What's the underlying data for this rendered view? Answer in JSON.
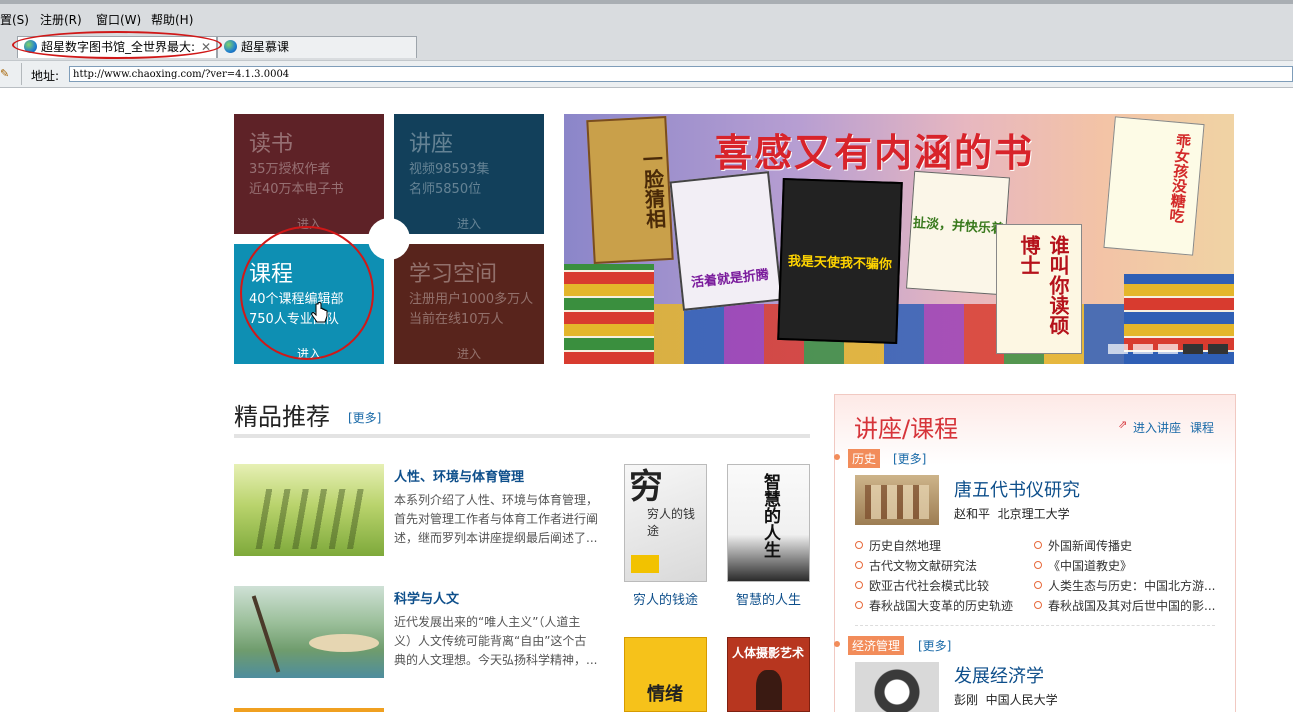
{
  "menubar": {
    "items": [
      "置(S)",
      "注册(R)",
      "窗口(W)",
      "帮助(H)"
    ]
  },
  "tabs": [
    {
      "label": "超星数字图书馆_全世界最大:",
      "active": true
    },
    {
      "label": "超星慕课",
      "active": false
    }
  ],
  "address": {
    "label": "地址:",
    "value": "http://www.chaoxing.com/?ver=4.1.3.0004"
  },
  "tiles": {
    "reading": {
      "title": "读书",
      "line1": "35万授权作者",
      "line2": "近40万本电子书",
      "enter": "进入"
    },
    "lecture": {
      "title": "讲座",
      "line1": "视频98593集",
      "line2": "名师5850位",
      "enter": "进入"
    },
    "course": {
      "title": "课程",
      "line1": "40个课程编辑部",
      "line2": "750人专业团队",
      "enter": "进入"
    },
    "study": {
      "title": "学习空间",
      "line1": "注册用户1000多万人",
      "line2": "当前在线10万人",
      "enter": "进入"
    }
  },
  "banner": {
    "headline": "喜感又有内涵的书",
    "books": [
      "一脸猜相",
      "活着就是折腾",
      "我是天使我不骗你",
      "扯淡，并快乐着",
      "谁叫你读硕博士",
      "乖女孩没糖吃"
    ]
  },
  "recommend": {
    "title": "精品推荐",
    "more": "[更多]",
    "items": [
      {
        "title": "人性、环境与体育管理",
        "desc": [
          "本系列介绍了人性、环境与体育管理，",
          "首先对管理工作者与体育工作者进行阐",
          "述，继而罗列本讲座提纲最后阐述了..."
        ]
      },
      {
        "title": "科学与人文",
        "desc": [
          "近代发展出来的“唯人主义”（人道主",
          "义）人文传统可能背离“自由”这个古",
          "典的人文理想。今天弘扬科学精神，..."
        ]
      }
    ],
    "books": [
      {
        "title": "穷人的钱途",
        "cover": "穷人的钱途"
      },
      {
        "title": "智慧的人生",
        "cover": "智慧的人生"
      },
      {
        "cover": "情绪"
      },
      {
        "cover": "人体摄影艺术"
      }
    ]
  },
  "lecture_panel": {
    "title": "讲座/课程",
    "links": [
      "进入讲座",
      "课程"
    ],
    "categories": [
      {
        "tag": "历史",
        "more": "[更多]",
        "feature": {
          "title": "唐五代书仪研究",
          "author": "赵和平  北京理工大学"
        },
        "items": [
          "历史自然地理",
          "外国新闻传播史",
          "古代文物文献研究法",
          "《中国道教史》",
          "欧亚古代社会模式比较",
          "人类生态与历史：中国北方游...",
          "春秋战国大变革的历史轨迹",
          "春秋战国及其对后世中国的影..."
        ]
      },
      {
        "tag": "经济管理",
        "more": "[更多]",
        "feature": {
          "title": "发展经济学",
          "author": "彭刚  中国人民大学"
        }
      }
    ]
  },
  "colors": {
    "reading_tile": "#5e2227",
    "lecture_tile": "#12405b",
    "course_tile": "#0e8fb3",
    "study_tile": "#58241c",
    "accent_red": "#d6343a",
    "link_blue": "#0e4f8b"
  }
}
